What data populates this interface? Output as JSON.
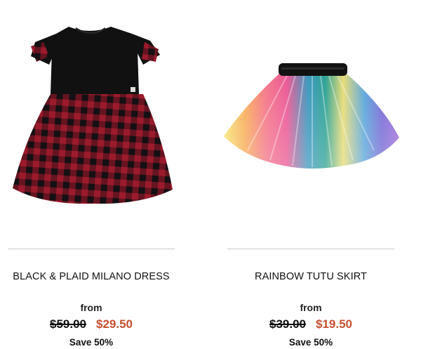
{
  "colors": {
    "sale_price": "#c4502f",
    "divider": "#c9c9c9"
  },
  "products": [
    {
      "image_icon": "plaid-dress-image",
      "title": "BLACK & PLAID MILANO DRESS",
      "from_label": "from",
      "original_price": "$59.00",
      "sale_price": "$29.50",
      "savings": "Save 50%"
    },
    {
      "image_icon": "rainbow-tutu-image",
      "title": "RAINBOW TUTU SKIRT",
      "from_label": "from",
      "original_price": "$39.00",
      "sale_price": "$19.50",
      "savings": "Save 50%"
    }
  ]
}
